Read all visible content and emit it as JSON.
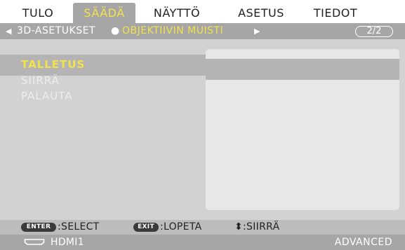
{
  "tabs": [
    {
      "label": "TULO",
      "active": false
    },
    {
      "label": "SÄÄDÄ",
      "active": true
    },
    {
      "label": "NÄYTTÖ",
      "active": false
    },
    {
      "label": "ASETUS",
      "active": false
    },
    {
      "label": "TIEDOT",
      "active": false
    }
  ],
  "subheader": {
    "left_arrow": "◀",
    "crumb1": "3D-ASETUKSET",
    "separator": "●",
    "crumb2": "OBJEKTIIVIN MUISTI",
    "right_arrow": "▶",
    "page": "2/2"
  },
  "menu": {
    "items": [
      {
        "label": "TALLETUS",
        "selected": true
      },
      {
        "label": "SIIRRÄ",
        "selected": false
      },
      {
        "label": "PALAUTA",
        "selected": false
      }
    ]
  },
  "help": {
    "enter_key": "ENTER",
    "enter_text": ":SELECT",
    "exit_key": "EXIT",
    "exit_text": ":LOPETA",
    "move_text": "⬍:SIIRRÄ"
  },
  "footer": {
    "source": "HDMI1",
    "mode": "ADVANCED"
  },
  "colors": {
    "accent_yellow": "#f2e34a",
    "bar_gray": "#a6a6a6",
    "panel_gray": "#d2d2d2",
    "highlight_gray": "#b4b4b4"
  }
}
